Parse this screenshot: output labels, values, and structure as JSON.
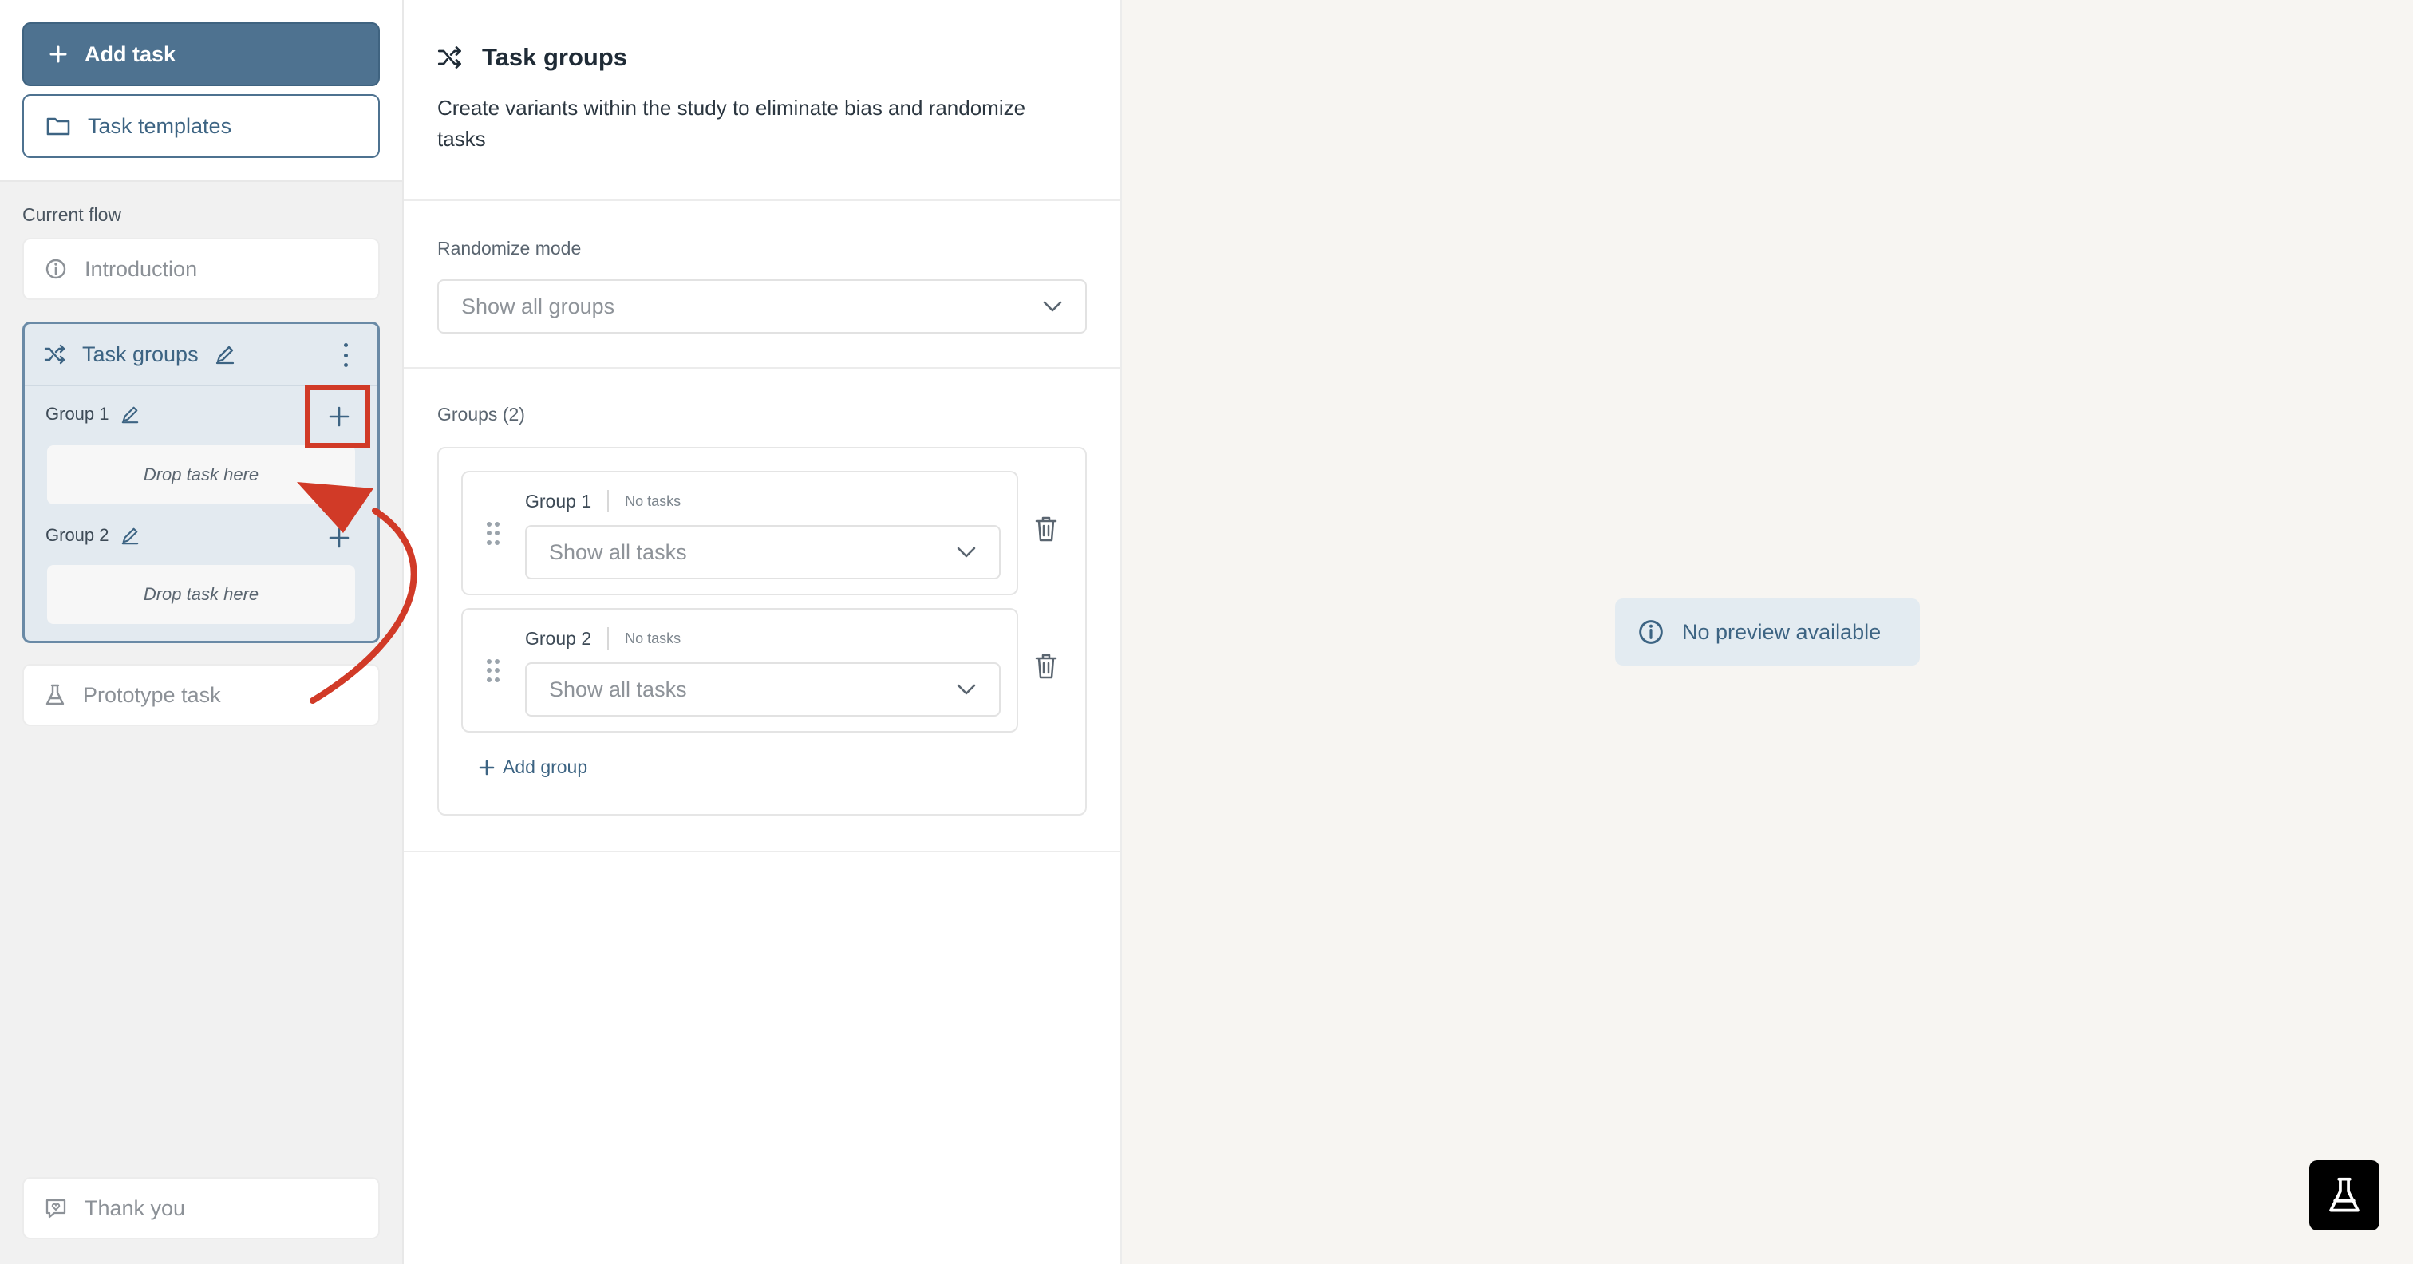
{
  "sidebar": {
    "add_task_label": "Add task",
    "task_templates_label": "Task templates",
    "current_flow_label": "Current flow",
    "introduction_label": "Introduction",
    "task_groups": {
      "title": "Task groups",
      "groups": [
        {
          "name": "Group 1",
          "drop_label": "Drop task here"
        },
        {
          "name": "Group 2",
          "drop_label": "Drop task here"
        }
      ]
    },
    "prototype_task_label": "Prototype task",
    "thank_you_label": "Thank you"
  },
  "main": {
    "title": "Task groups",
    "description": "Create variants within the study to eliminate bias and randomize tasks",
    "randomize_mode_label": "Randomize mode",
    "randomize_mode_value": "Show all groups",
    "groups_label": "Groups (2)",
    "groups": [
      {
        "name": "Group 1",
        "count": "No tasks",
        "select_value": "Show all tasks"
      },
      {
        "name": "Group 2",
        "count": "No tasks",
        "select_value": "Show all tasks"
      }
    ],
    "add_group_label": "Add group"
  },
  "preview": {
    "message": "No preview available"
  },
  "colors": {
    "accent": "#4e7290",
    "annotation": "#d13a27"
  }
}
